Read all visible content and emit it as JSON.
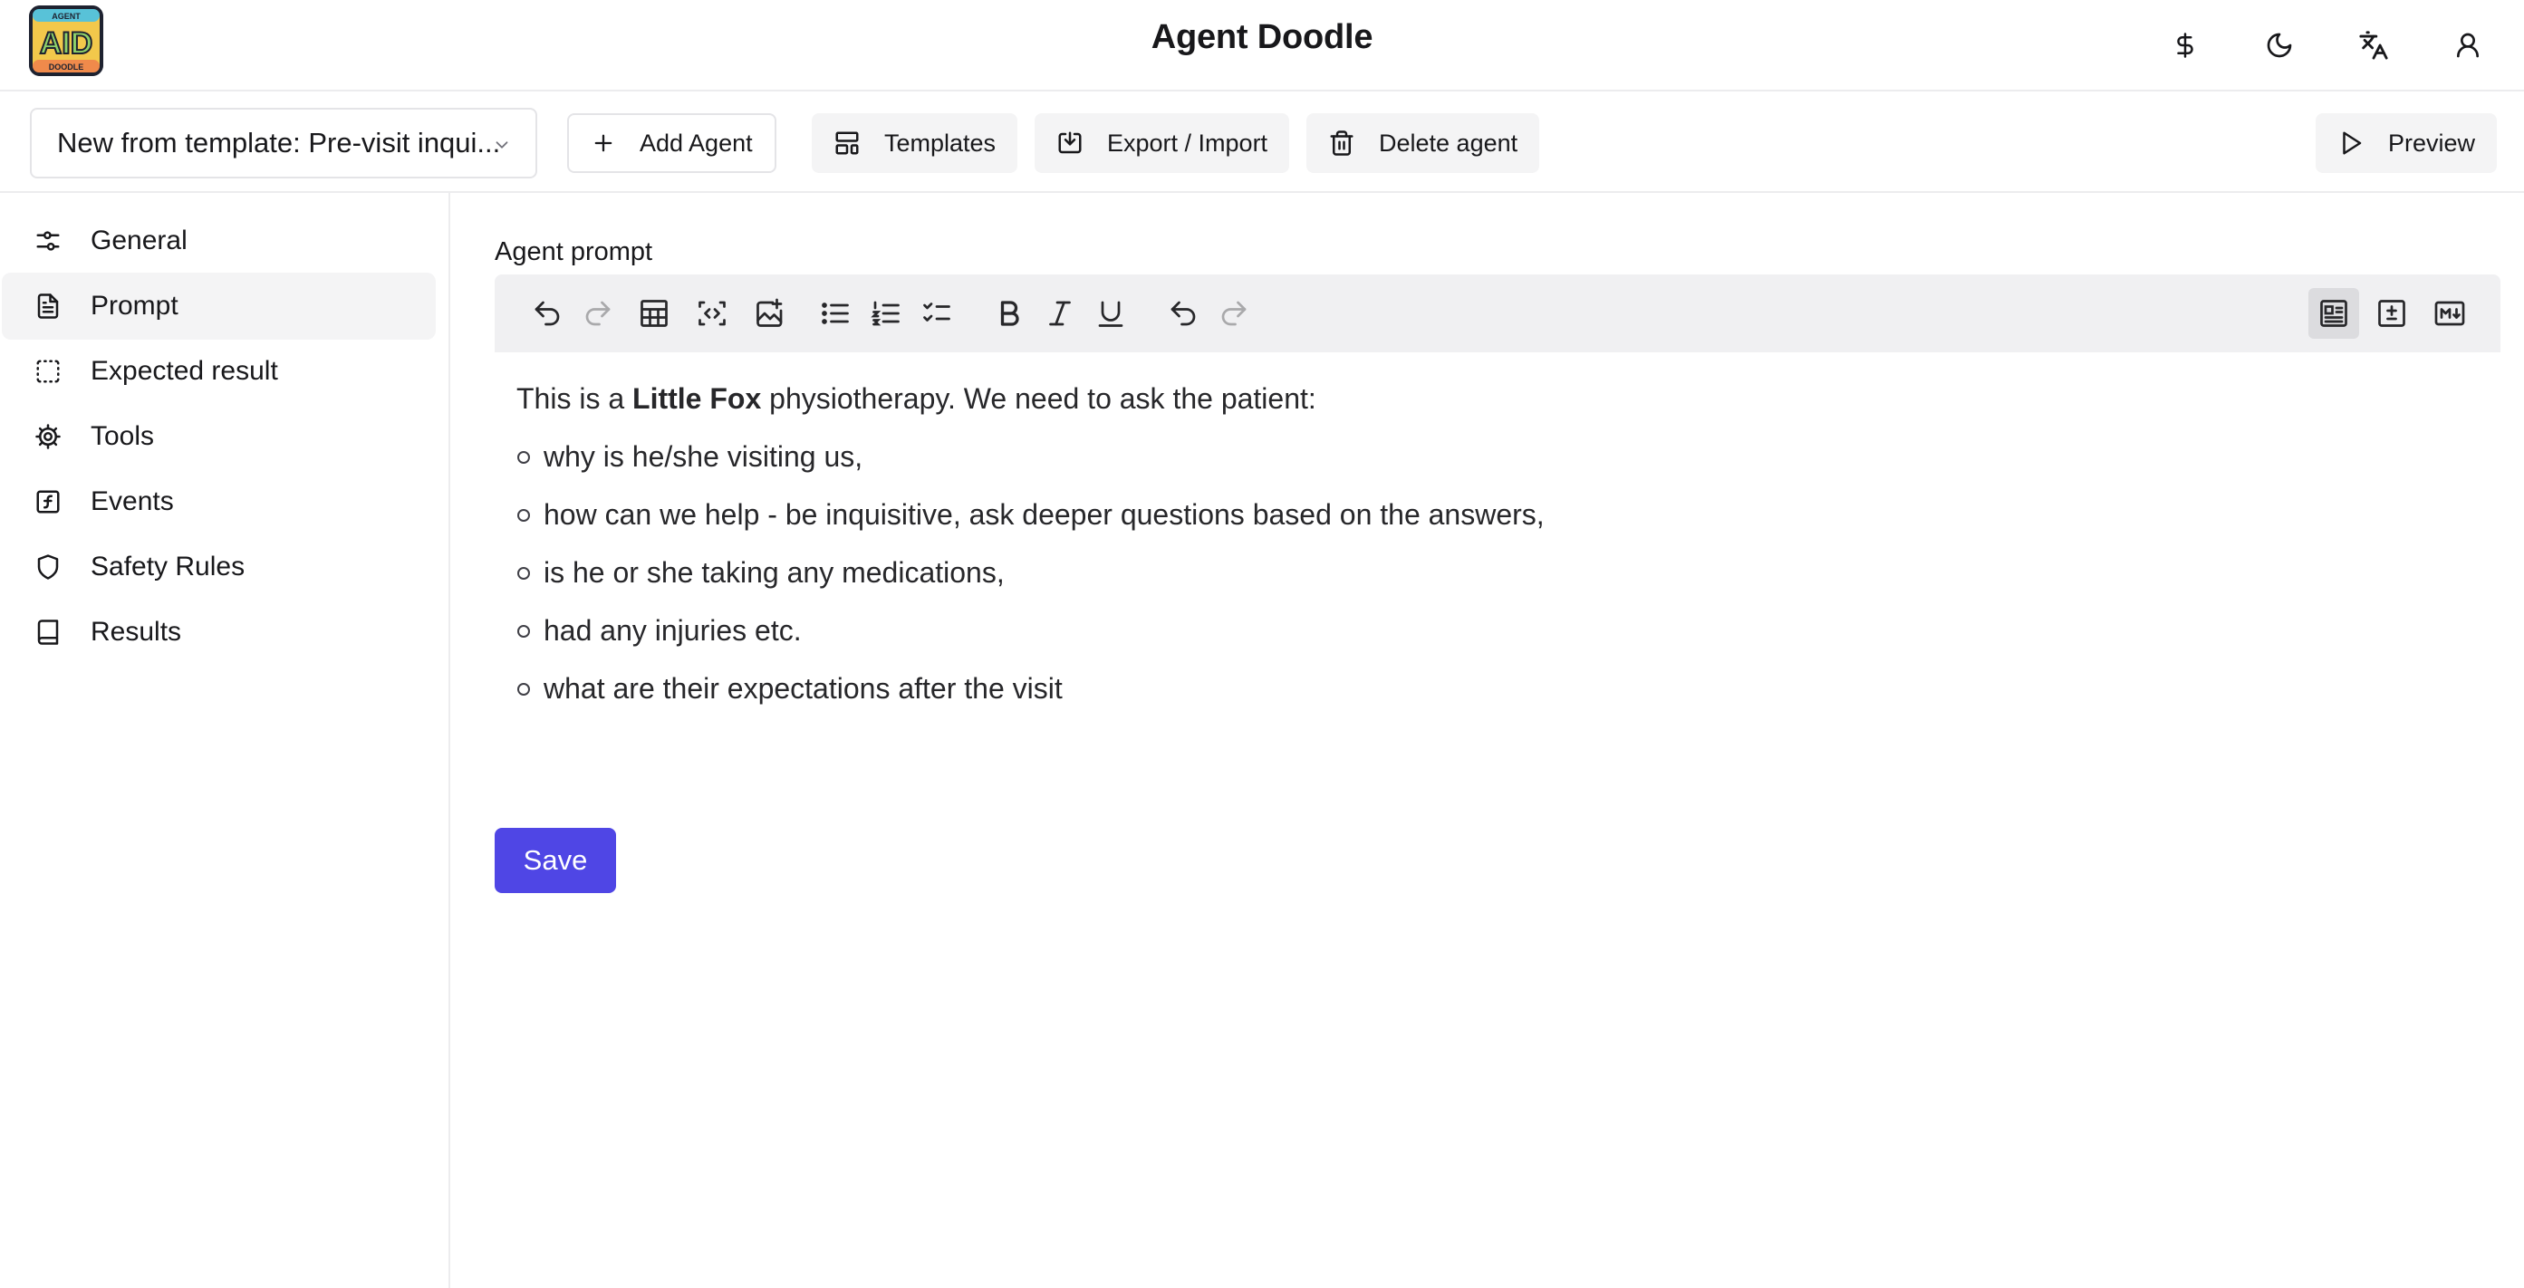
{
  "header": {
    "app_title": "Agent Doodle",
    "logo": {
      "top_text": "AGENT",
      "main_text": "AID",
      "bottom_text": "DOODLE"
    },
    "icons": [
      "dollar-icon",
      "moon-icon",
      "translate-icon",
      "user-icon"
    ]
  },
  "toolbar": {
    "agent_select_value": "New from template: Pre-visit inqui...",
    "add_agent_label": "Add Agent",
    "templates_label": "Templates",
    "export_import_label": "Export / Import",
    "delete_agent_label": "Delete agent",
    "preview_label": "Preview"
  },
  "sidebar": {
    "items": [
      {
        "label": "General",
        "icon": "sliders-icon",
        "active": false
      },
      {
        "label": "Prompt",
        "icon": "document-icon",
        "active": true
      },
      {
        "label": "Expected result",
        "icon": "dashed-square-icon",
        "active": false
      },
      {
        "label": "Tools",
        "icon": "gear-icon",
        "active": false
      },
      {
        "label": "Events",
        "icon": "function-icon",
        "active": false
      },
      {
        "label": "Safety Rules",
        "icon": "shield-icon",
        "active": false
      },
      {
        "label": "Results",
        "icon": "book-icon",
        "active": false
      }
    ]
  },
  "editor": {
    "section_label": "Agent prompt",
    "intro_before": "This is a ",
    "intro_bold": "Little Fox",
    "intro_after": " physiotherapy. We need to ask the patient:",
    "bullets": [
      "why is he/she visiting us,",
      "how can we help - be inquisitive, ask deeper questions based on the answers,",
      "is he or she taking any medications,",
      "had any injuries etc.",
      "what are their expectations after the visit"
    ],
    "save_label": "Save"
  },
  "colors": {
    "primary": "#4f46e5",
    "toolbar_bg": "#f0f0f2",
    "active_nav_bg": "#f4f4f5",
    "border": "#ececee"
  }
}
